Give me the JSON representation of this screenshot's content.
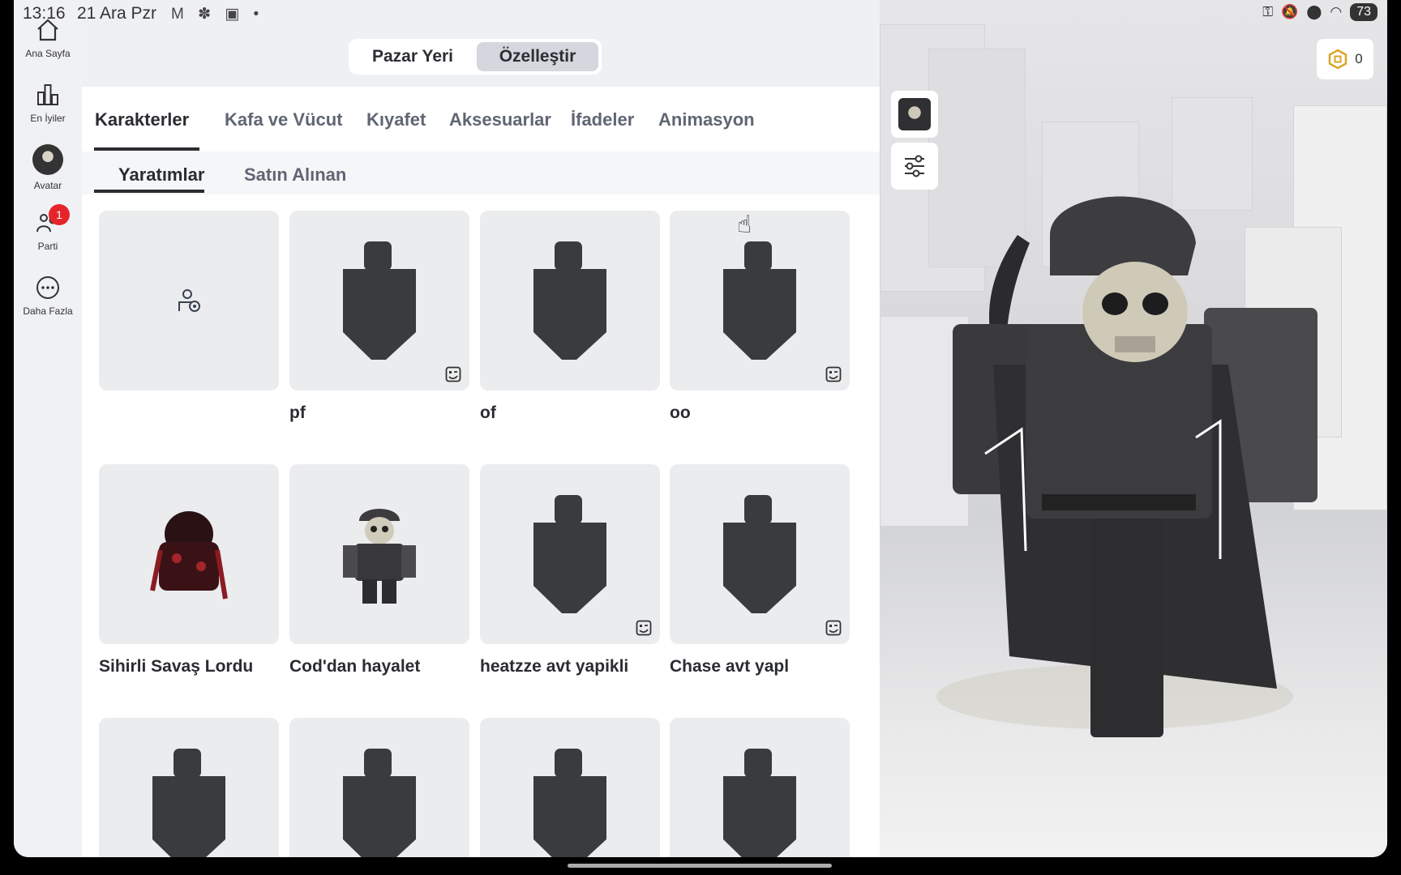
{
  "status": {
    "time": "13:16",
    "date": "21 Ara Pzr",
    "icons": "M ✽ ▣ •",
    "battery": "73"
  },
  "rail": {
    "items": [
      {
        "label": "Ana Sayfa",
        "icon": "home-icon"
      },
      {
        "label": "En İyiler",
        "icon": "chart-icon"
      },
      {
        "label": "Avatar",
        "icon": "avatar-icon"
      },
      {
        "label": "Parti",
        "icon": "party-icon",
        "badge": "1"
      },
      {
        "label": "Daha Fazla",
        "icon": "more-icon"
      }
    ]
  },
  "segment": {
    "marketplace": "Pazar Yeri",
    "customize": "Özelleştir"
  },
  "tabs": [
    "Karakterler",
    "Kafa ve Vücut",
    "Kıyafet",
    "Aksesuarlar",
    "İfadeler",
    "Animasyon"
  ],
  "subtabs": [
    "Yaratımlar",
    "Satın Alınan"
  ],
  "cards": [
    {
      "title": "",
      "kind": "create"
    },
    {
      "title": "pf",
      "kind": "body",
      "custom": true
    },
    {
      "title": "of",
      "kind": "body",
      "custom": false
    },
    {
      "title": "oo",
      "kind": "body",
      "custom": true
    },
    {
      "title": "Sihirli Savaş Lordu",
      "kind": "avatar-red"
    },
    {
      "title": "Cod'dan hayalet",
      "kind": "avatar-ghost"
    },
    {
      "title": "heatzze avt yapikli",
      "kind": "body",
      "custom": true
    },
    {
      "title": "Chase avt yapl",
      "kind": "body",
      "custom": true
    },
    {
      "title": "",
      "kind": "body",
      "custom": false
    },
    {
      "title": "",
      "kind": "body",
      "custom": false
    },
    {
      "title": "",
      "kind": "body",
      "custom": false
    },
    {
      "title": "",
      "kind": "body",
      "custom": false
    }
  ],
  "robux": {
    "amount": "0"
  },
  "colors": {
    "accent": "#2a2c31",
    "badge": "#e5252a"
  }
}
